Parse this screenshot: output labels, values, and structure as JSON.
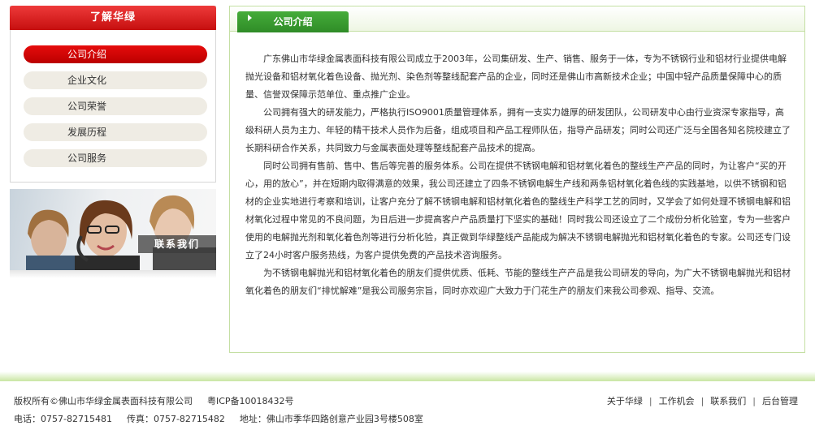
{
  "sidebar": {
    "title": "了解华绿",
    "items": [
      {
        "label": "公司介绍",
        "active": true
      },
      {
        "label": "企业文化"
      },
      {
        "label": "公司荣誉"
      },
      {
        "label": "发展历程"
      },
      {
        "label": "公司服务"
      }
    ],
    "contact_label": "联系我们"
  },
  "main": {
    "tab_label": "公司介绍",
    "paragraphs": [
      "广东佛山市华绿金属表面科技有限公司成立于2003年，公司集研发、生产、销售、服务于一体，专为不锈钢行业和铝材行业提供电解抛光设备和铝材氧化着色设备、抛光剂、染色剂等整线配套产品的企业，同时还是佛山市高新技术企业；中国中轻产品质量保障中心的质量、信誉双保障示范单位、重点推广企业。",
      "公司拥有强大的研发能力，严格执行ISO9001质量管理体系，拥有一支实力雄厚的研发团队，公司研发中心由行业资深专家指导，高级科研人员为主力、年轻的精干技术人员作为后备，组成项目和产品工程师队伍，指导产品研发；同时公司还广泛与全国各知名院校建立了长期科研合作关系，共同致力与金属表面处理等整线配套产品技术的提高。",
      "同时公司拥有售前、售中、售后等完善的服务体系。公司在提供不锈钢电解和铝材氧化着色的整线生产产品的同时，为让客户“买的开心，用的放心”，并在短期内取得满意的效果，我公司还建立了四条不锈钢电解生产线和两条铝材氧化着色线的实践基地，以供不锈钢和铝材的企业实地进行考察和培训，让客户充分了解不锈钢电解和铝材氧化着色的整线生产科学工艺的同时，又学会了如何处理不锈钢电解和铝材氧化过程中常见的不良问题，为日后进一步提高客户产品质量打下坚实的基础！同时我公司还设立了二个成份分析化验室，专为一些客户使用的电解抛光剂和氧化着色剂等进行分析化验，真正做到华绿整线产品能成为解决不锈钢电解抛光和铝材氧化着色的专家。公司还专门设立了24小时客户服务热线，为客户提供免费的产品技术咨询服务。",
      "为不锈钢电解抛光和铝材氧化着色的朋友们提供优质、低耗、节能的整线生产产品是我公司研发的导向，为广大不锈钢电解抛光和铝材氧化着色的朋友们“排忧解难”是我公司服务宗旨，同时亦欢迎广大致力于门花生产的朋友们来我公司参观、指导、交流。"
    ]
  },
  "footer": {
    "copyright": "版权所有©佛山市华绿金属表面科技有限公司",
    "icp": "粤ICP备10018432号",
    "phone": "电话：0757-82715481",
    "fax": "传真：0757-82715482",
    "address": "地址：佛山市季华四路创意产业园3号楼508室",
    "links": [
      "关于华绿",
      "工作机会",
      "联系我们",
      "后台管理"
    ]
  },
  "colors": {
    "sidebar_accent": "#d40000",
    "main_accent": "#3a9c30",
    "border_green": "#c4dfa3"
  }
}
